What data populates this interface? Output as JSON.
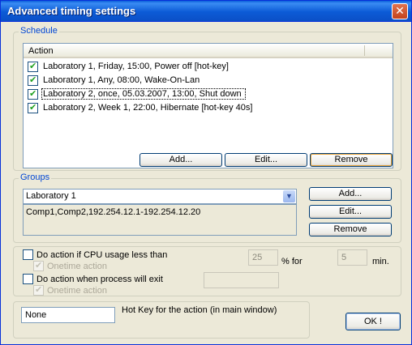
{
  "window": {
    "title": "Advanced timing settings"
  },
  "schedule": {
    "group_label": "Schedule",
    "column_header": "Action",
    "rows": [
      {
        "checked": true,
        "text": "Laboratory 1, Friday, 15:00, Power off [hot-key]"
      },
      {
        "checked": true,
        "text": "Laboratory 1, Any, 08:00, Wake-On-Lan"
      },
      {
        "checked": true,
        "text": "Laboratory 2, once, 05.03.2007, 13:00, Shut down"
      },
      {
        "checked": true,
        "text": "Laboratory 2, Week 1, 22:00, Hibernate [hot-key 40s]"
      }
    ],
    "add_label": "Add...",
    "edit_label": "Edit...",
    "remove_label": "Remove"
  },
  "groups": {
    "group_label": "Groups",
    "selected": "Laboratory 1",
    "members": "Comp1,Comp2,192.254.12.1-192.254.12.20",
    "add_label": "Add...",
    "edit_label": "Edit...",
    "remove_label": "Remove"
  },
  "conditions": {
    "cpu_label": "Do action if CPU usage less than",
    "cpu_onetime_label": "Onetime action",
    "cpu_value": "25",
    "percent_for_label": "% for",
    "minutes_value": "5",
    "min_label": "min.",
    "process_label": "Do action when process will exit",
    "process_onetime_label": "Onetime action",
    "process_value": ""
  },
  "hotkey": {
    "value": "None",
    "label": "Hot Key for the action (in main window)"
  },
  "ok_label": "OK !"
}
